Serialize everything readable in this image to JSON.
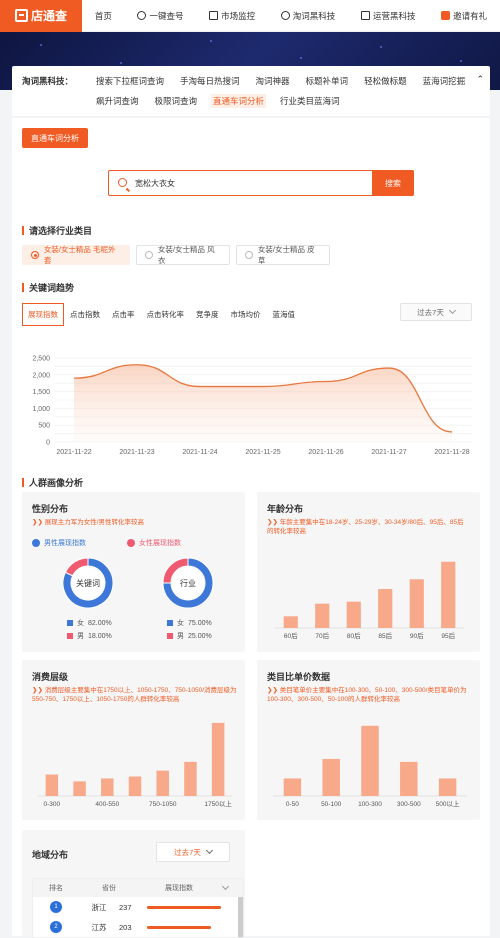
{
  "brand": {
    "name": "店通查",
    "accent": "#f05a23"
  },
  "nav": [
    {
      "label": "首页",
      "icon": ""
    },
    {
      "label": "一键查号",
      "icon": "eye-icon"
    },
    {
      "label": "市场监控",
      "icon": "monitor-icon"
    },
    {
      "label": "淘词黑科技",
      "icon": "search-icon"
    },
    {
      "label": "运营黑科技",
      "icon": "tools-icon"
    },
    {
      "label": "邀请有礼",
      "icon": "gift-icon"
    }
  ],
  "tools": {
    "label": "淘词黑科技：",
    "row1": [
      "搜索下拉框词查询",
      "手淘每日热搜词",
      "淘词神器",
      "标题补单词",
      "轻松做标题",
      "蓝海词挖掘"
    ],
    "row2": [
      "飙升词查询",
      "极限词查询",
      "直通车词分析",
      "行业类目蓝海词"
    ],
    "active": "直通车词分析"
  },
  "page_button": "直通车词分析",
  "search": {
    "value": "宽松大衣女",
    "button": "搜索"
  },
  "industry": {
    "title": "请选择行业类目",
    "options": [
      "女装/女士精品 毛呢外套",
      "女装/女士精品 风衣",
      "女装/女士精品 皮草"
    ],
    "selected": 0
  },
  "trend": {
    "title": "关键词趋势",
    "tabs": [
      "展现指数",
      "点击指数",
      "点击率",
      "点击转化率",
      "竞争度",
      "市场均价",
      "蓝海值"
    ],
    "active": 0,
    "range": "过去7天"
  },
  "chart_data": [
    {
      "type": "area",
      "x": [
        "2021-11-22",
        "2021-11-23",
        "2021-11-24",
        "2021-11-25",
        "2021-11-26",
        "2021-11-27",
        "2021-11-28"
      ],
      "values": [
        1900,
        2300,
        1650,
        1650,
        1800,
        2200,
        300
      ],
      "yticks": [
        "0",
        "250",
        "500",
        "750",
        "1,000",
        "1,250",
        "1,500",
        "1,750",
        "2,000",
        "2,250",
        "2,500"
      ],
      "ylim": [
        0,
        2500
      ],
      "color": "#e8763d"
    },
    {
      "type": "pie",
      "title": "关键词",
      "categories": [
        "女",
        "男"
      ],
      "values": [
        82,
        18
      ],
      "labels": [
        "82.00%",
        "18.00%"
      ],
      "colors": [
        "#3d78d8",
        "#f05a70"
      ]
    },
    {
      "type": "pie",
      "title": "行业",
      "categories": [
        "女",
        "男"
      ],
      "values": [
        75,
        25
      ],
      "labels": [
        "75.00%",
        "25.00%"
      ],
      "colors": [
        "#3d78d8",
        "#f05a70"
      ]
    },
    {
      "type": "bar",
      "categories": [
        "60后",
        "70后",
        "80后",
        "85后",
        "90后",
        "95后"
      ],
      "values": [
        12,
        25,
        27,
        40,
        50,
        68
      ],
      "color": "#f7a98a"
    },
    {
      "type": "bar",
      "categories": [
        "0-300",
        "",
        "400-550",
        "",
        "750-1050",
        "",
        "1750以上"
      ],
      "values": [
        22,
        15,
        18,
        20,
        26,
        35,
        75
      ],
      "color": "#f7a98a"
    },
    {
      "type": "bar",
      "categories": [
        "0-50",
        "50-100",
        "100-300",
        "300-500",
        "500以上"
      ],
      "values": [
        18,
        38,
        72,
        35,
        18
      ],
      "color": "#f7a98a"
    }
  ],
  "crowd": {
    "title": "人群画像分析",
    "gender": {
      "title": "性别分布",
      "desc": "❯❯ 展现主力军为女性/男性转化率较高",
      "btn_male": "男性展现指数",
      "btn_female": "女性展现指数",
      "legend_female": "女",
      "legend_male": "男"
    },
    "age": {
      "title": "年龄分布",
      "desc": "❯❯ 年龄主要集中在18-24岁、25-29岁、30-34岁/80后、95后、85后的转化率较高"
    },
    "consume": {
      "title": "消费层级",
      "desc": "❯❯ 消费层级主要集中在1750以上、1050-1750、750-1050/消费层级为550-750、1750以上、1050-1750的人群转化率较高"
    },
    "price": {
      "title": "类目比单价数据",
      "desc": "❯❯ 类目笔单价主要集中在100-300、50-100、300-500/类目笔单价为100-300、300-500、50-100的人群转化率较高"
    }
  },
  "region": {
    "title": "地域分布",
    "range": "过去7天",
    "headers": [
      "排名",
      "省份",
      "展现指数"
    ],
    "rows": [
      {
        "rank": "1",
        "province": "浙江",
        "value": "237",
        "pct": 1.0
      },
      {
        "rank": "2",
        "province": "江苏",
        "value": "203",
        "pct": 0.86
      }
    ]
  }
}
